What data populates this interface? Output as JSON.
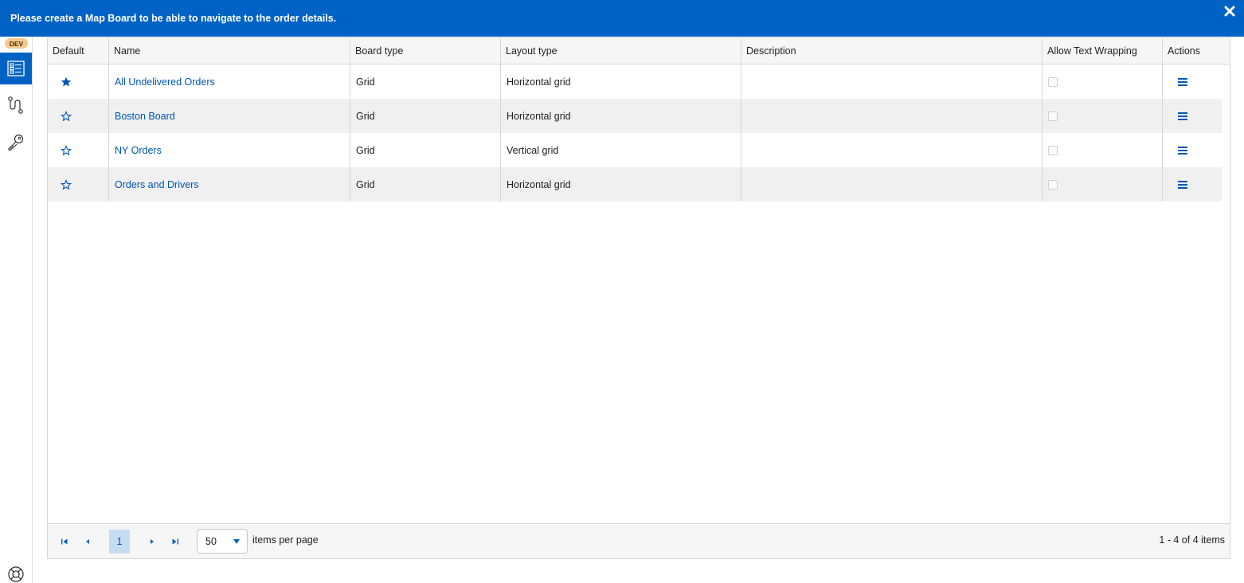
{
  "banner": {
    "message": "Please create a Map Board to be able to navigate to the order details.",
    "close_icon": "close-icon",
    "color": "#0062c4"
  },
  "sidebar": {
    "badge": "DEV",
    "items": [
      {
        "name": "boards",
        "icon": "list-board-icon",
        "active": true
      },
      {
        "name": "routes",
        "icon": "route-icon",
        "active": false
      },
      {
        "name": "keys",
        "icon": "key-icon",
        "active": false
      }
    ],
    "help_icon": "lifebuoy-icon"
  },
  "table": {
    "columns": [
      "Default",
      "Name",
      "Board type",
      "Layout type",
      "Description",
      "Allow Text Wrapping",
      "Actions"
    ],
    "rows": [
      {
        "default": true,
        "name": "All Undelivered Orders",
        "board_type": "Grid",
        "layout_type": "Horizontal grid",
        "description": "",
        "allow_text_wrapping": false
      },
      {
        "default": false,
        "name": "Boston Board",
        "board_type": "Grid",
        "layout_type": "Horizontal grid",
        "description": "",
        "allow_text_wrapping": false
      },
      {
        "default": false,
        "name": "NY Orders",
        "board_type": "Grid",
        "layout_type": "Vertical grid",
        "description": "",
        "allow_text_wrapping": false
      },
      {
        "default": false,
        "name": "Orders and Drivers",
        "board_type": "Grid",
        "layout_type": "Horizontal grid",
        "description": "",
        "allow_text_wrapping": false
      }
    ]
  },
  "pager": {
    "current_page": "1",
    "page_size": "50",
    "items_per_page_label": "items per page",
    "info": "1 - 4 of 4 items"
  },
  "colors": {
    "accent": "#0062c4",
    "link": "#0056b3",
    "row_alt": "#f0f0f0"
  }
}
